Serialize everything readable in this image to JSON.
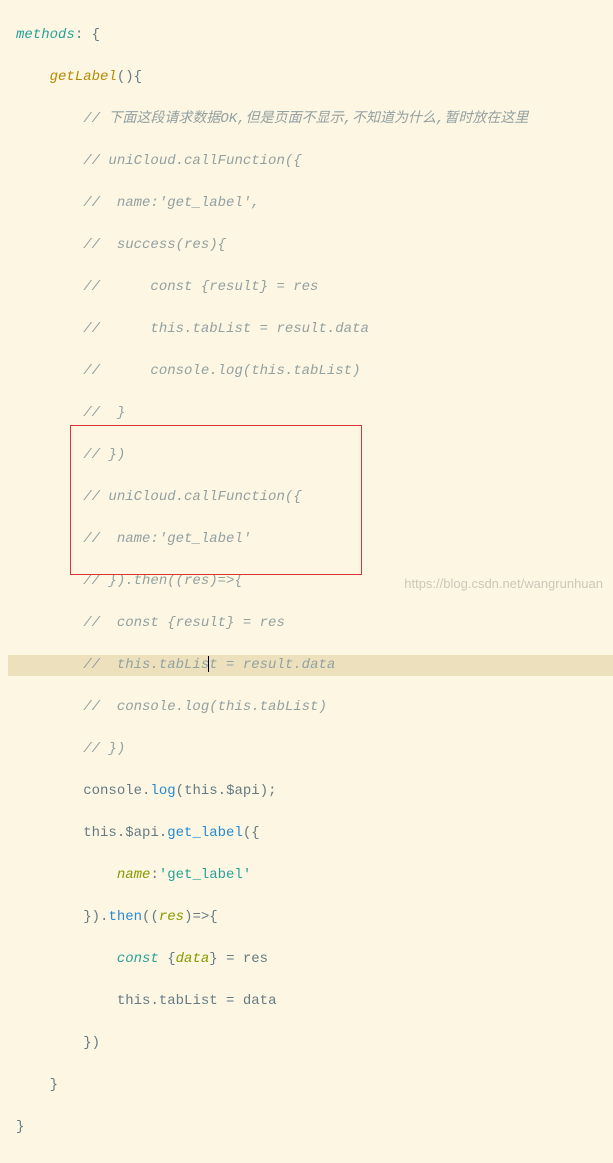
{
  "code": {
    "l1a": "methods",
    "l1b": ": {",
    "l2a": "getLabel",
    "l2b": "(){",
    "c1": "// 下面这段请求数据OK,但是页面不显示,不知道为什么,暂时放在这里",
    "c2": "// uniCloud.callFunction({",
    "c3": "//  name:'get_label',",
    "c4": "//  success(res){",
    "c5": "//      const {result} = res",
    "c6": "//      this.tabList = result.data",
    "c7": "//      console.log(this.tabList)",
    "c8": "//  }",
    "c9": "// })",
    "c10": "// uniCloud.callFunction({",
    "c11": "//  name:'get_label'",
    "c12": "// }).then((res)=>{",
    "c13": "//  const {result} = res",
    "c14a": "//  this.tabLis",
    "c14b": "t = result.data",
    "c15": "//  console.log(this.tabList)",
    "c16": "// })",
    "a1_console": "console",
    "a1_log": "log",
    "a1_this": "this",
    "a1_api": "$api",
    "a2_this": "this",
    "a2_api": "$api",
    "a2_fn": "get_label",
    "a3_name": "name",
    "a3_val": "'get_label'",
    "a4_then": "then",
    "a4_res": "res",
    "a5_const": "const",
    "a5_data": "data",
    "a5_res": "res",
    "a6_this": "this",
    "a6_tab": "tabList",
    "a6_data": "data",
    "close1": "})",
    "close2": "}",
    "close3": "}"
  },
  "watermark": "https://blog.csdn.net/wangrunhuan"
}
